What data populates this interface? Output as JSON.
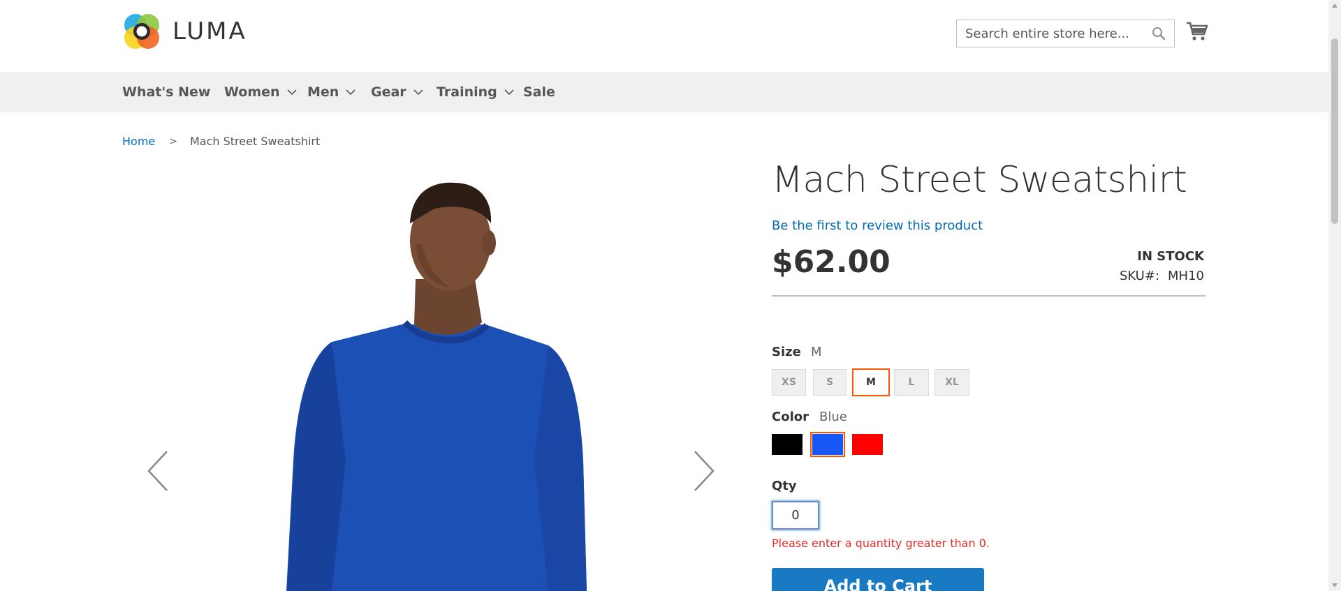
{
  "header": {
    "logo_text": "LUMA",
    "search_placeholder": "Search entire store here...",
    "icons": {
      "search": "search-icon",
      "cart": "cart-icon"
    }
  },
  "nav": {
    "items": [
      {
        "label": "What's New",
        "has_dropdown": false
      },
      {
        "label": "Women",
        "has_dropdown": true
      },
      {
        "label": "Men",
        "has_dropdown": true
      },
      {
        "label": "Gear",
        "has_dropdown": true
      },
      {
        "label": "Training",
        "has_dropdown": true
      },
      {
        "label": "Sale",
        "has_dropdown": false
      }
    ]
  },
  "breadcrumb": {
    "home": "Home",
    "separator": ">",
    "current": "Mach Street Sweatshirt"
  },
  "product": {
    "title": "Mach Street Sweatshirt",
    "review_link": "Be the first to review this product",
    "price": "$62.00",
    "stock": "IN STOCK",
    "sku_label": "SKU#:",
    "sku": "MH10",
    "size": {
      "label": "Size",
      "selected": "M",
      "options": [
        "XS",
        "S",
        "M",
        "L",
        "XL"
      ]
    },
    "color": {
      "label": "Color",
      "selected": "Blue",
      "options": [
        {
          "name": "Black",
          "hex": "#000000"
        },
        {
          "name": "Blue",
          "hex": "#1857f7"
        },
        {
          "name": "Red",
          "hex": "#ff0000"
        }
      ]
    },
    "qty": {
      "label": "Qty",
      "value": "0",
      "error": "Please enter a quantity greater than 0."
    },
    "add_to_cart": "Add to Cart"
  },
  "colors": {
    "accent": "#1979c3",
    "link": "#006bb4",
    "selected_border": "#ff5501",
    "error": "#e02b27",
    "nav_bg": "#f0f0f0"
  }
}
